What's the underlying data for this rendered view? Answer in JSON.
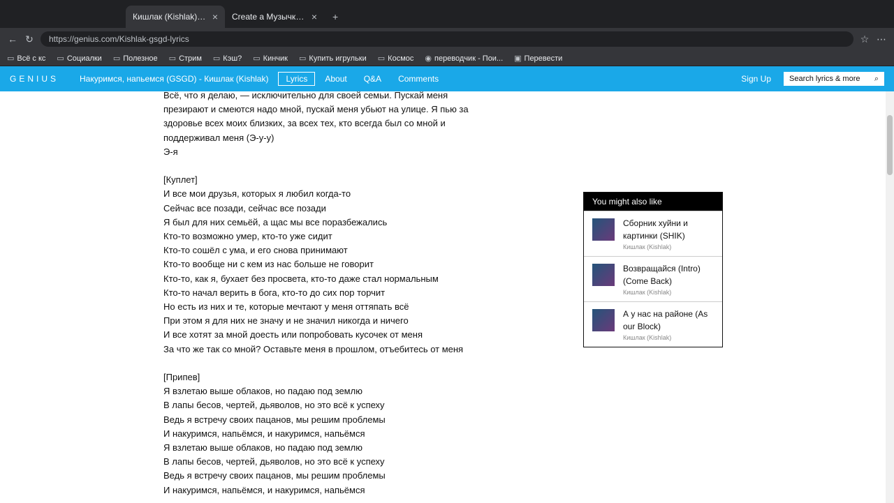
{
  "browser": {
    "tabs": [
      {
        "title": "Кишлак (Kishlak) – Накуримся, напьемся (GSGD) Lyrics",
        "active": true
      },
      {
        "title": "Create a Музычка Tier List - TierMaker",
        "active": false
      }
    ],
    "new_tab_icon": "plus-icon",
    "url": "https://genius.com/Kishlak-gsgd-lyrics",
    "bookmarks": [
      "Всё с кс",
      "Социалки",
      "Полезное",
      "Стрим",
      "Кэш?",
      "Кинчик",
      "Купить игрульки",
      "Космос",
      "переводчик - Пои...",
      "Перевести"
    ]
  },
  "header": {
    "logo": "GENIUS",
    "song": "Накуримся, напьемся (GSGD) - Кишлак (Kishlak)",
    "nav": [
      {
        "label": "Lyrics",
        "active": true
      },
      {
        "label": "About",
        "active": false
      },
      {
        "label": "Q&A",
        "active": false
      },
      {
        "label": "Comments",
        "active": false
      }
    ],
    "signup": "Sign Up",
    "search_placeholder": "Search lyrics & more"
  },
  "lyrics": [
    "Всё, что я делаю, — исключительно для своей семьи. Пускай меня",
    "презирают и смеются надо мной, пускай меня убьют на улице. Я пью за",
    "здоровье всех моих близких, за всех тех, кто всегда был со мной и",
    "поддерживал меня (Э-у-у)",
    "Э-я",
    "",
    "[Куплет]",
    "И все мои друзья, которых я любил когда-то",
    "Сейчас все позади, сейчас все позади",
    "Я был для них семьёй, а щас мы все поразбежались",
    "Кто-то возможно умер, кто-то уже сидит",
    "Кто-то сошёл с ума, и его снова принимают",
    "Кто-то вообще ни с кем из нас больше не говорит",
    "Кто-то, как я, бухает без просвета, кто-то даже стал нормальным",
    "Кто-то начал верить в бога, кто-то до сих пор торчит",
    "Но есть из них и те, которые мечтают у меня оттяпать всё",
    "При этом я для них не значу и не значил никогда и ничего",
    "И все хотят за мной доесть или попробовать кусочек от меня",
    "За что же так со мной? Оставьте меня в прошлом, отъебитесь от меня",
    "",
    "[Припев]",
    "Я взлетаю выше облаков, но падаю под землю",
    "В лапы бесов, чертей, дьяволов, но это всё к успеху",
    "Ведь я встречу своих пацанов, мы решим проблемы",
    "И накуримся, напьёмся, и накуримся, напьёмся",
    "Я взлетаю выше облаков, но падаю под землю",
    "В лапы бесов, чертей, дьяволов, но это всё к успеху",
    "Ведь я встречу своих пацанов, мы решим проблемы",
    "И накуримся, напьёмся, и накуримся, напьёмся"
  ],
  "sidebar": {
    "title": "You might also like",
    "items": [
      {
        "title": "Сборник хуйни и картинки (SHIK)",
        "artist": "Кишлак (Kishlak)"
      },
      {
        "title": "Возвращайся (Intro) (Come Back)",
        "artist": "Кишлак (Kishlak)"
      },
      {
        "title": "А у нас на районе (As our Block)",
        "artist": "Кишлак (Kishlak)"
      }
    ]
  }
}
